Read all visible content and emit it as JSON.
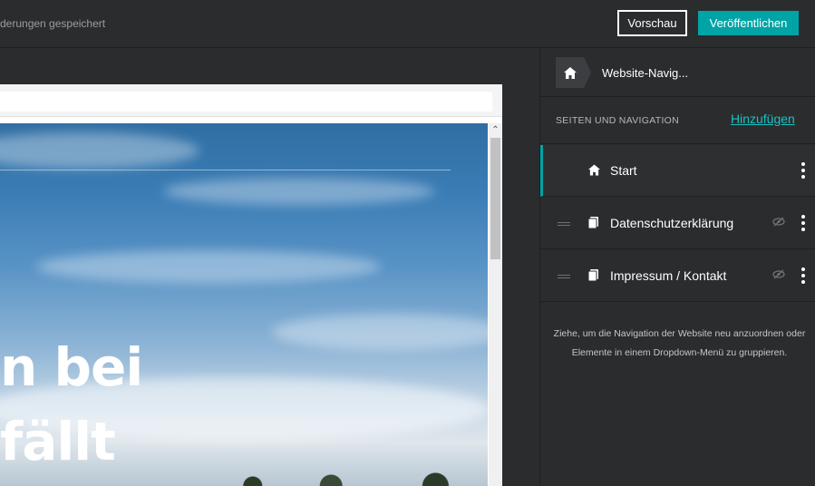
{
  "topbar": {
    "save_status": "derungen gespeichert",
    "preview_label": "Vorschau",
    "publish_label": "Veröffentlichen"
  },
  "preview": {
    "hero_line1": "n bei",
    "hero_line2": "fällt",
    "scroll_up_glyph": "⌃"
  },
  "panel": {
    "breadcrumb_label": "Website-Navig...",
    "section_title": "SEITEN UND NAVIGATION",
    "add_label": "Hinzufügen",
    "items": [
      {
        "label": "Start",
        "icon": "home-icon",
        "active": true,
        "hidden": false
      },
      {
        "label": "Datenschutzerklärung",
        "icon": "page-icon",
        "active": false,
        "hidden": true
      },
      {
        "label": "Impressum / Kontakt",
        "icon": "page-icon",
        "active": false,
        "hidden": true
      }
    ],
    "hint": "Ziehe, um die Navigation der Website neu anzuordnen oder Elemente in einem Dropdown-Menü zu gruppieren."
  },
  "colors": {
    "accent": "#00a4a6",
    "link": "#19c3c4",
    "background": "#2b2c2e"
  }
}
